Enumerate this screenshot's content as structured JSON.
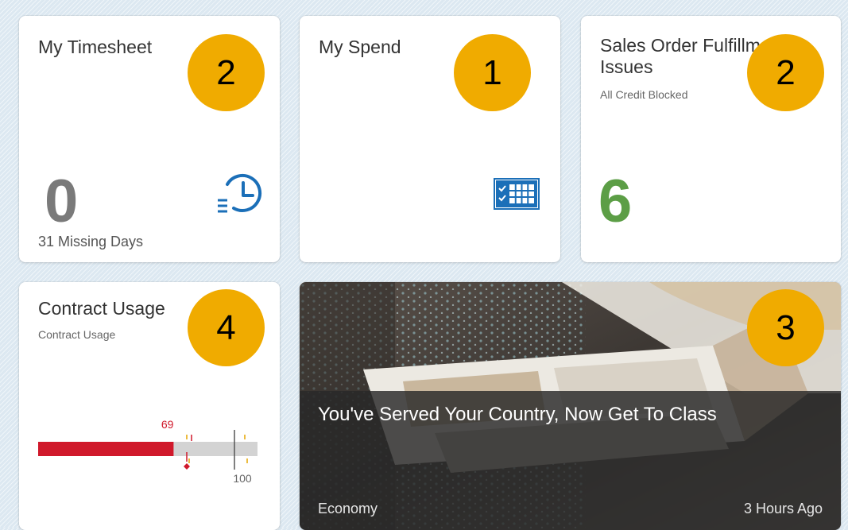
{
  "tiles": {
    "timesheet": {
      "title": "My Timesheet",
      "value": "0",
      "footer": "31 Missing Days",
      "badge": "2",
      "icon": "clock-list-icon"
    },
    "spend": {
      "title": "My Spend",
      "badge": "1",
      "icon": "calendar-check-icon"
    },
    "sales": {
      "title_line1": "Sales Order Fulfillm",
      "title_line2": "Issues",
      "subtitle": "All Credit Blocked",
      "value": "6",
      "badge": "2"
    },
    "contract": {
      "title": "Contract Usage",
      "subtitle": "Contract Usage",
      "badge": "4",
      "bullet": {
        "actual_label": "69",
        "actual": 69,
        "target_label": "100",
        "target": 100,
        "max": 115,
        "actual_color": "#d0192b"
      }
    },
    "news": {
      "title": "You've Served Your Country, Now Get To Class",
      "category": "Economy",
      "time": "3 Hours Ago",
      "badge": "3"
    }
  },
  "colors": {
    "badge": "#f0ab00",
    "icon_blue": "#1b6fb8",
    "kpi_gray": "#7a7a7a",
    "kpi_green": "#5c9e46",
    "bullet_red": "#d0192b"
  }
}
